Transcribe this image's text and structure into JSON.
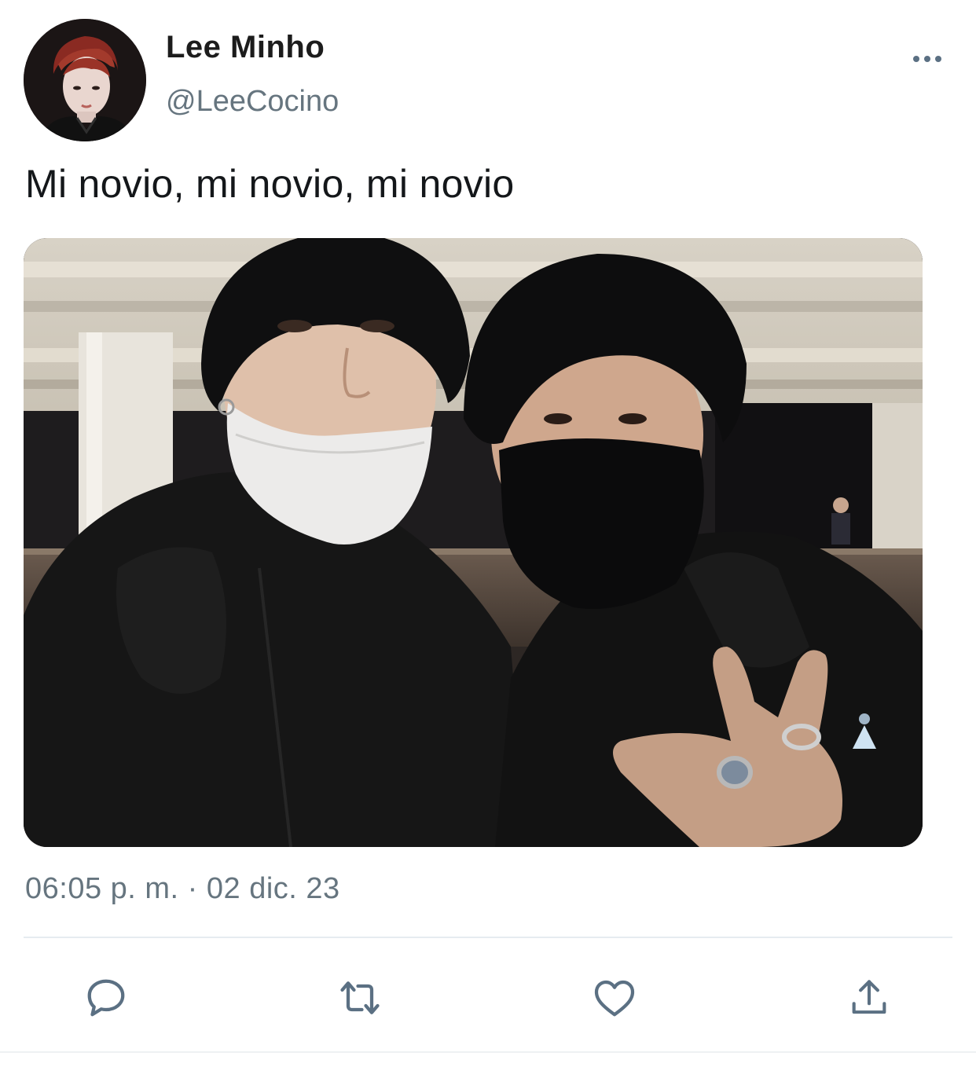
{
  "tweet": {
    "author": {
      "name": "Lee Minho",
      "handle": "@LeeCocino"
    },
    "text": "Mi novio, mi novio, mi novio",
    "timestamp": "06:05 p. m. · 02 dic. 23",
    "media": {
      "type": "photo"
    }
  },
  "actions": {
    "reply_icon": "speech-bubble-icon",
    "retweet_icon": "retweet-arrows-icon",
    "like_icon": "heart-icon",
    "share_icon": "share-upload-icon"
  },
  "colors": {
    "text_primary": "#14171a",
    "text_secondary": "#66757f",
    "icon": "#5b7083",
    "divider": "#e6ecf0"
  }
}
